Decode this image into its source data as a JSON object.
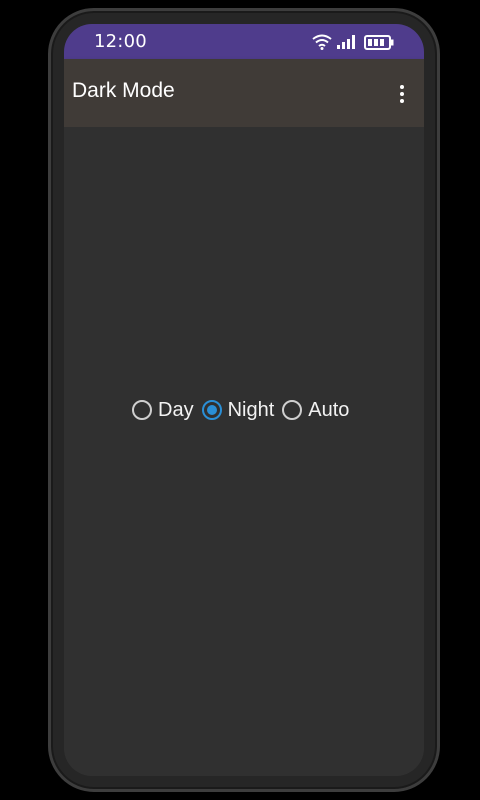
{
  "status_bar": {
    "time": "12:00",
    "icons": [
      "wifi-icon",
      "signal-icon",
      "battery-icon"
    ],
    "background": "#4f3c8c"
  },
  "app_bar": {
    "title": "Dark Mode",
    "overflow_icon": "more-vert-icon",
    "background": "#403b37"
  },
  "theme_options": {
    "selected": "Night",
    "accent": "#2a8fd6",
    "items": [
      {
        "label": "Day",
        "checked": false
      },
      {
        "label": "Night",
        "checked": true
      },
      {
        "label": "Auto",
        "checked": false
      }
    ]
  },
  "colors": {
    "screen_background": "#303030",
    "frame": "#262626"
  }
}
